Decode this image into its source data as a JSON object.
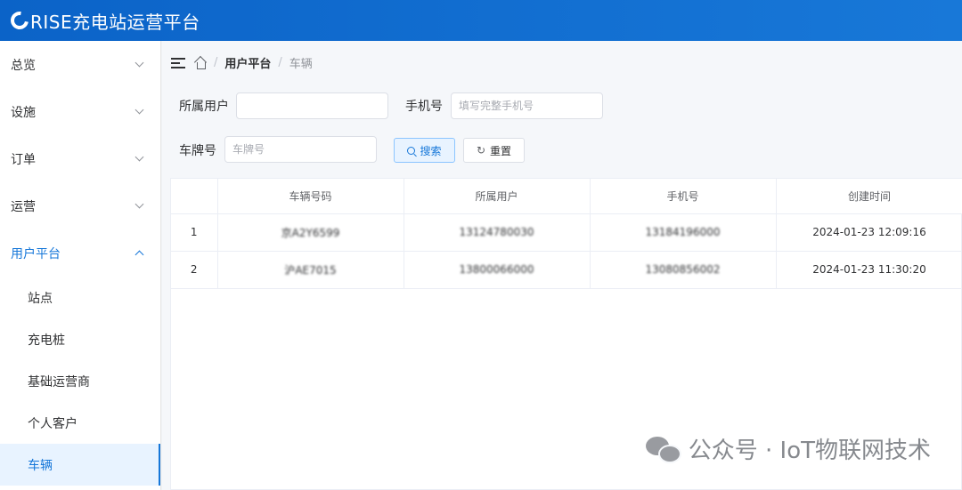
{
  "app": {
    "title": "RISE充电站运营平台"
  },
  "sidebar": {
    "menus": [
      {
        "label": "总览",
        "expanded": false
      },
      {
        "label": "设施",
        "expanded": false
      },
      {
        "label": "订单",
        "expanded": false
      },
      {
        "label": "运营",
        "expanded": false
      },
      {
        "label": "用户平台",
        "expanded": true
      }
    ],
    "submenu": [
      {
        "label": "站点"
      },
      {
        "label": "充电桩"
      },
      {
        "label": "基础运营商"
      },
      {
        "label": "个人客户"
      },
      {
        "label": "车辆",
        "selected": true
      }
    ]
  },
  "breadcrumb": {
    "parent": "用户平台",
    "current": "车辆"
  },
  "filters": {
    "owner_label": "所属用户",
    "owner_value": "",
    "phone_label": "手机号",
    "phone_placeholder": "填写完整手机号",
    "plate_label": "车牌号",
    "plate_placeholder": "车牌号",
    "search_label": "搜索",
    "reset_label": "重置"
  },
  "table": {
    "columns": [
      "",
      "车辆号码",
      "所属用户",
      "手机号",
      "创建时间"
    ],
    "rows": [
      {
        "index": "1",
        "plate": "京A2Y6599",
        "owner": "13124780030",
        "phone": "13184196000",
        "created": "2024-01-23 12:09:16"
      },
      {
        "index": "2",
        "plate": "沪AE7015",
        "owner": "13800066000",
        "phone": "13080856002",
        "created": "2024-01-23 11:30:20"
      }
    ]
  },
  "watermark": {
    "text": "公众号 · IoT物联网技术"
  },
  "colors": {
    "accent": "#1677d9",
    "topbar": "#0b63c8"
  }
}
